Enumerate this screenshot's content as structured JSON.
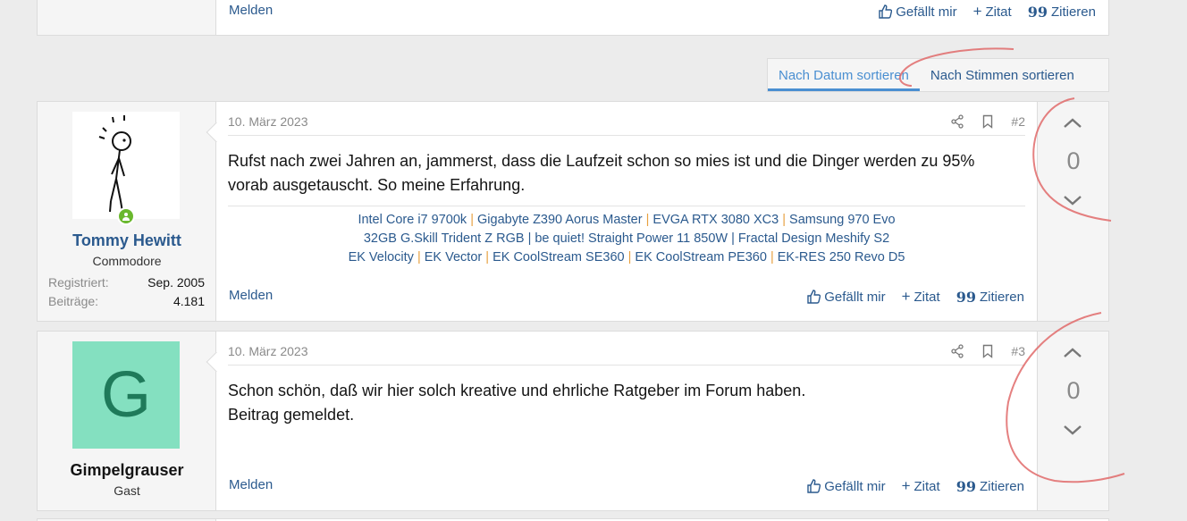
{
  "prev_post": {
    "report_label": "Melden",
    "like_label": "Gefällt mir",
    "quote_label": "Zitat",
    "cite_label": "Zitieren"
  },
  "sort": {
    "tabs": [
      {
        "label": "Nach Datum sortieren",
        "active": true
      },
      {
        "label": "Nach Stimmen sortieren",
        "active": false
      }
    ]
  },
  "posts": [
    {
      "author": {
        "name": "Tommy Hewitt",
        "title": "Commodore",
        "registered_label": "Registriert:",
        "registered_value": "Sep. 2005",
        "posts_label": "Beiträge:",
        "posts_value": "4.181",
        "online": true
      },
      "date": "10. März 2023",
      "number": "#2",
      "body_lines": [
        "Rufst nach zwei Jahren an, jammerst, dass die Laufzeit schon so mies ist und die Dinger werden zu 95%",
        "vorab ausgetauscht. So meine Erfahrung."
      ],
      "signature": {
        "line1": [
          "Intel Core i7 9700k",
          "Gigabyte Z390 Aorus Master",
          "EVGA RTX 3080 XC3",
          "Samsung 970 Evo"
        ],
        "line2": "32GB G.Skill Trident Z RGB | be quiet! Straight Power 11 850W | Fractal Design Meshify S2",
        "line3": [
          "EK Velocity",
          "EK Vector",
          "EK CoolStream SE360",
          "EK CoolStream PE360",
          "EK-RES 250 Revo D5"
        ]
      },
      "score": "0",
      "report_label": "Melden",
      "like_label": "Gefällt mir",
      "quote_label": "Zitat",
      "cite_label": "Zitieren"
    },
    {
      "author": {
        "name": "Gimpelgrauser",
        "title": "Gast",
        "avatar_letter": "G",
        "avatar_color": "#84e0c0",
        "avatar_letter_color": "#1f7a5a"
      },
      "date": "10. März 2023",
      "number": "#3",
      "body_lines": [
        "Schon schön, daß wir hier solch kreative und ehrliche Ratgeber im Forum haben.",
        "Beitrag gemeldet."
      ],
      "score": "0",
      "report_label": "Melden",
      "like_label": "Gefällt mir",
      "quote_label": "Zitat",
      "cite_label": "Zitieren"
    }
  ],
  "colors": {
    "link": "#2b5a8e",
    "accent": "#4a8fd1",
    "separator": "#e8a040",
    "annotation": "#e06a6a"
  }
}
